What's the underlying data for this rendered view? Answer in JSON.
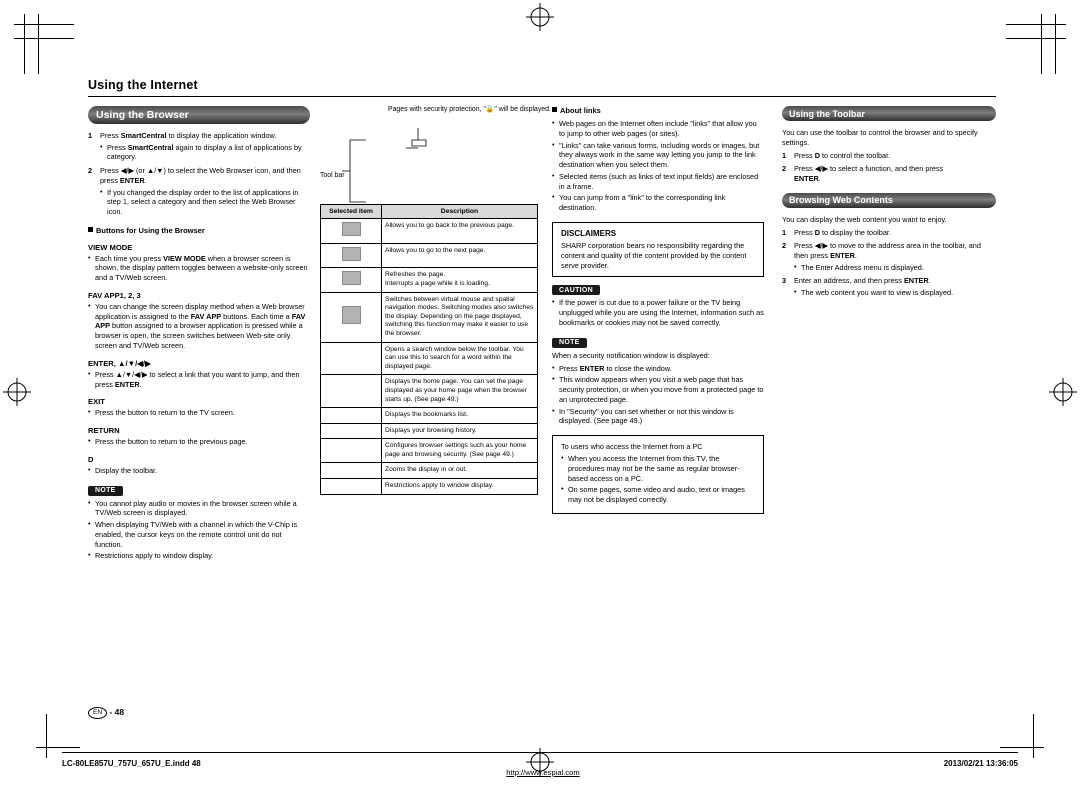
{
  "header": {
    "doc_title": "Using the Internet"
  },
  "colA": {
    "section_title": "Using the Browser",
    "steps": [
      {
        "n": "1",
        "text": "Press SmartCentral to display the application window.",
        "bold_terms": [
          "SmartCentral"
        ],
        "subs": [
          "Press SmartCentral again to display a list of applications by category."
        ]
      },
      {
        "n": "2",
        "text": "Press c/d (or a/b) to select the Web Browser icon, and then press ENTER.",
        "subs": [
          "If you changed the display order to the list of applications in step 1, select a category and then select the Web Browser icon."
        ]
      }
    ],
    "buttons_head": "Buttons for Using the Browser",
    "terms": [
      {
        "term": "VIEW MODE",
        "bullets": [
          "Each time you press VIEW MODE when a browser screen is shown, the display pattern toggles between a website-only screen and a TV/Web screen."
        ]
      },
      {
        "term": "FAV APP1, 2, 3",
        "bullets": [
          "You can change the screen display method when a Web browser application is assigned to the FAV APP buttons. Each time a FAV APP button assigned to a browser application is pressed while a browser is open, the screen switches between Web-site only screen and TV/Web screen."
        ]
      },
      {
        "term": "ENTER, a/b/c/d",
        "bullets": [
          "Press a/b/c/d to select a link that you want to jump, and then press ENTER."
        ]
      },
      {
        "term": "EXIT",
        "bullets": [
          "Press the button to return to the TV screen."
        ]
      },
      {
        "term": "RETURN",
        "bullets": [
          "Press the button to return to the previous page."
        ]
      },
      {
        "term": "D",
        "bullets": [
          "Display the toolbar."
        ]
      }
    ],
    "note_label": "NOTE",
    "notes": [
      "You cannot play audio or movies in the browser screen while a TV/Web screen is displayed.",
      "When displaying TV/Web with a channel in which the V-Chip is enabled, the cursor keys on the remote control unit do not function.",
      "Restrictions apply to window display."
    ]
  },
  "colB": {
    "callout": "Pages with security protection, \"🔒\" will be displayed.",
    "toolbar_label": "Tool bar",
    "table": {
      "headers": [
        "Selected item",
        "Description"
      ],
      "rows": [
        {
          "icon": "back-icon",
          "desc": "Allows you to go back to the previous page."
        },
        {
          "icon": "forward-icon",
          "desc": "Allows you to go to the next page."
        },
        {
          "icon": "reload-icon",
          "desc": "Refreshes the page.\nInterrupts a page while it is loading."
        },
        {
          "icon": "pointer-mode-icon",
          "desc": "Switches between virtual mouse and spatial navigation modes. Switching modes also switches the display. Depending on the page displayed, switching this function may make it easier to use the browser."
        },
        {
          "icon": "search-icon",
          "desc": "Opens a search window below the toolbar. You can use this to search for a word within the displayed page."
        },
        {
          "icon": "home-icon",
          "desc": "Displays the home page. You can set the page displayed as your home page when the browser starts up. (See page 49.)"
        },
        {
          "icon": "bookmark-icon",
          "desc": "Displays the bookmarks list."
        },
        {
          "icon": "history-icon",
          "desc": "Displays your browsing history."
        },
        {
          "icon": "settings-icon",
          "desc": "Configures browser settings such as your home page and browsing security. (See page 49.)"
        },
        {
          "icon": "zoom-icon",
          "desc": "Zooms the display in or out."
        },
        {
          "icon": "window-icon",
          "desc": "Restrictions apply to window display."
        }
      ]
    }
  },
  "colC": {
    "about_links_head": "About links",
    "bullets": [
      "Web pages on the Internet often include \"links\" that allow you to jump to other web pages (or sites).",
      "\"Links\" can take various forms, including words or images, but they always work in the same way letting you jump to the link destination when you select them.",
      "Selected items (such as links of text input fields) are enclosed in a frame.",
      "You can jump from a \"link\" to the corresponding link destination."
    ],
    "disclaimers_title": "DISCLAIMERS",
    "disclaimers_text": "SHARP corporation bears no responsibility regarding the content and quality of the content provided by the content serve provider.",
    "caution_label": "CAUTION",
    "caution_text": "If the power is cut due to a power failure or the TV being unplugged while you are using the Internet, information such as bookmarks or cookies may not be saved correctly.",
    "note_label": "NOTE",
    "notes_intro": "When a security notification window is displayed:",
    "notes": [
      "Press ENTER to close the window.",
      "This window appears when you visit a web page that has security protection, or when you move from a protected page to an unprotected page.",
      "In \"Security\" you can set whether or not this window is displayed. (See page 49.)"
    ],
    "pc_box": [
      "To users who access the Internet from a PC",
      "When you access the Internet from this TV, the procedures may not be the same as regular browser-based access on a PC.",
      "On some pages, some video and audio, text or images may not be displayed correctly."
    ]
  },
  "colD": {
    "toolbar_head": "Using the Toolbar",
    "toolbar_intro": "You can use the toolbar to control the browser and to specify settings.",
    "toolbar_steps": [
      {
        "n": "1",
        "text": "Press D to control the toolbar.",
        "subs": []
      },
      {
        "n": "2",
        "text": "Press c/d to select a function, and then press ENTER.",
        "subs": []
      }
    ],
    "web_head": "Browsing Web Contents",
    "web_intro": "You can display the web content you want to enjoy.",
    "web_steps": [
      {
        "n": "1",
        "text": "Press D to display the toolbar.",
        "subs": []
      },
      {
        "n": "2",
        "text": "Press c/d to move to the address area in the toolbar, and then press ENTER.",
        "subs": [
          "The Enter Address menu is displayed."
        ]
      },
      {
        "n": "3",
        "text": "Enter an address, and then press ENTER.",
        "subs": [
          "The web content you want to view is displayed."
        ]
      }
    ]
  },
  "footer": {
    "url": "http://www.espial.com",
    "page_mark": "EN",
    "page_number": "48",
    "file_name": "LC-80LE857U_757U_657U_E.indd   48",
    "timestamp": "2013/02/21   13:36:05"
  }
}
